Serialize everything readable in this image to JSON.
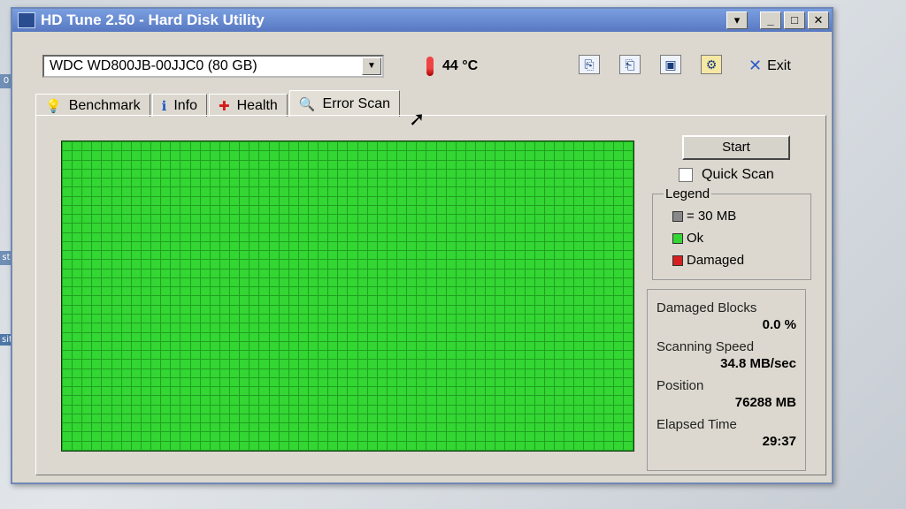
{
  "window": {
    "title": "HD Tune 2.50 - Hard Disk Utility"
  },
  "toolbar": {
    "drive": "WDC WD800JB-00JJC0 (80 GB)",
    "temperature": "44 °C",
    "exit_label": "Exit"
  },
  "tabs": [
    {
      "label": "Benchmark",
      "icon": "lightbulb-icon"
    },
    {
      "label": "Info",
      "icon": "info-icon"
    },
    {
      "label": "Health",
      "icon": "health-cross-icon"
    },
    {
      "label": "Error Scan",
      "icon": "magnifier-icon",
      "active": true
    }
  ],
  "scan": {
    "start_label": "Start",
    "quick_scan_label": "Quick Scan",
    "quick_scan_checked": false,
    "legend_title": "Legend",
    "legend": [
      {
        "label": "= 30 MB",
        "color": "#888888"
      },
      {
        "label": "Ok",
        "color": "#33d633"
      },
      {
        "label": "Damaged",
        "color": "#d62020"
      }
    ],
    "stats": {
      "damaged_blocks_label": "Damaged Blocks",
      "damaged_blocks_value": "0.0 %",
      "scanning_speed_label": "Scanning Speed",
      "scanning_speed_value": "34.8 MB/sec",
      "position_label": "Position",
      "position_value": "76288 MB",
      "elapsed_label": "Elapsed Time",
      "elapsed_value": "29:37"
    },
    "block_status": "ok"
  },
  "desktop": {
    "label_fragment": "siti",
    "icon_letters": [
      "0",
      "st"
    ]
  }
}
